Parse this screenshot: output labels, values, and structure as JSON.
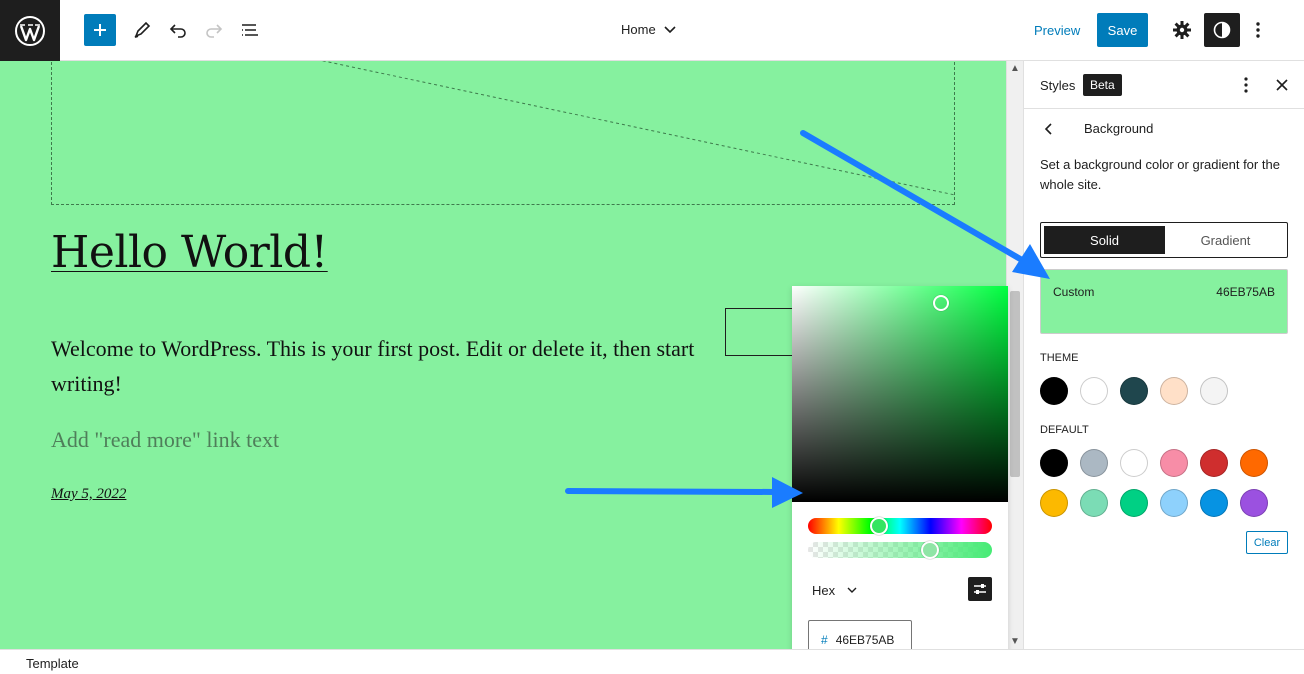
{
  "header": {
    "document_title": "Home",
    "preview_label": "Preview",
    "save_label": "Save"
  },
  "canvas": {
    "heading": "Hello World!",
    "excerpt": "Welcome to WordPress. This is your first post. Edit or delete it, then start writing!",
    "read_more_placeholder": "Add \"read more\" link text",
    "date": "May 5, 2022",
    "background_color": "#86f19f"
  },
  "color_picker": {
    "format": "Hex",
    "hex_prefix": "#",
    "hex_value": "46EB75AB",
    "hue_color": "#00ff40"
  },
  "footer": {
    "breadcrumb": "Template"
  },
  "sidebar": {
    "title": "Styles",
    "badge": "Beta",
    "panel_title": "Background",
    "description": "Set a background color or gradient for the whole site.",
    "tabs": {
      "solid": "Solid",
      "gradient": "Gradient"
    },
    "custom_label": "Custom",
    "custom_value": "46EB75AB",
    "theme_label": "THEME",
    "theme_colors": [
      "#000000",
      "#ffffff",
      "#1f464d",
      "#ffe0c8",
      "#f4f4f4"
    ],
    "default_label": "DEFAULT",
    "default_colors_row1": [
      "#000000",
      "#abb8c3",
      "#ffffff",
      "#f78da7",
      "#cf2e2e",
      "#ff6900"
    ],
    "default_colors_row2": [
      "#fcb900",
      "#7bdcb5",
      "#00d084",
      "#8ed1fc",
      "#0693e3",
      "#9b51e0"
    ],
    "clear_label": "Clear"
  },
  "colors": {
    "accent": "#007cba",
    "annotation_arrow": "#1a7cff"
  }
}
